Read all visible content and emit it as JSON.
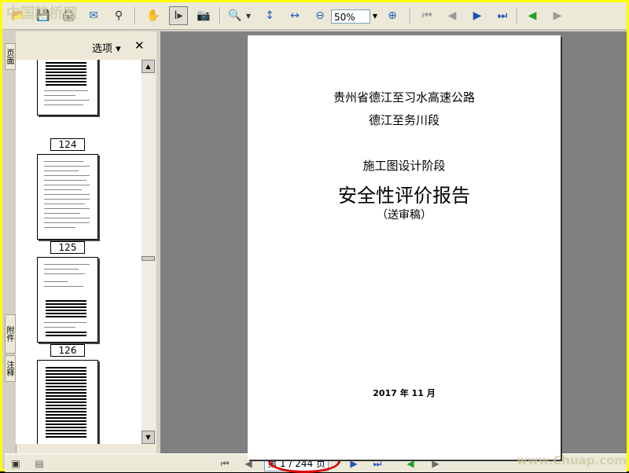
{
  "toolbar": {
    "zoom_value": "50%"
  },
  "panel": {
    "options_label": "选项 ▾",
    "close_label": "✕",
    "tabs": [
      "页面",
      "附件",
      "注释"
    ],
    "thumbnail_labels": [
      "124",
      "125",
      "126"
    ]
  },
  "document": {
    "line1": "贵州省德江至习水高速公路",
    "line2": "德江至务川段",
    "line3": "施工图设计阶段",
    "title": "安全性评价报告",
    "subtitle": "（送审稿）",
    "date": "2017 年 11 月"
  },
  "status": {
    "page_indicator": "第 1 / 244 页"
  },
  "watermarks": {
    "top_left": "中国路桥网",
    "bottom_right": "www.Chuap.com"
  }
}
